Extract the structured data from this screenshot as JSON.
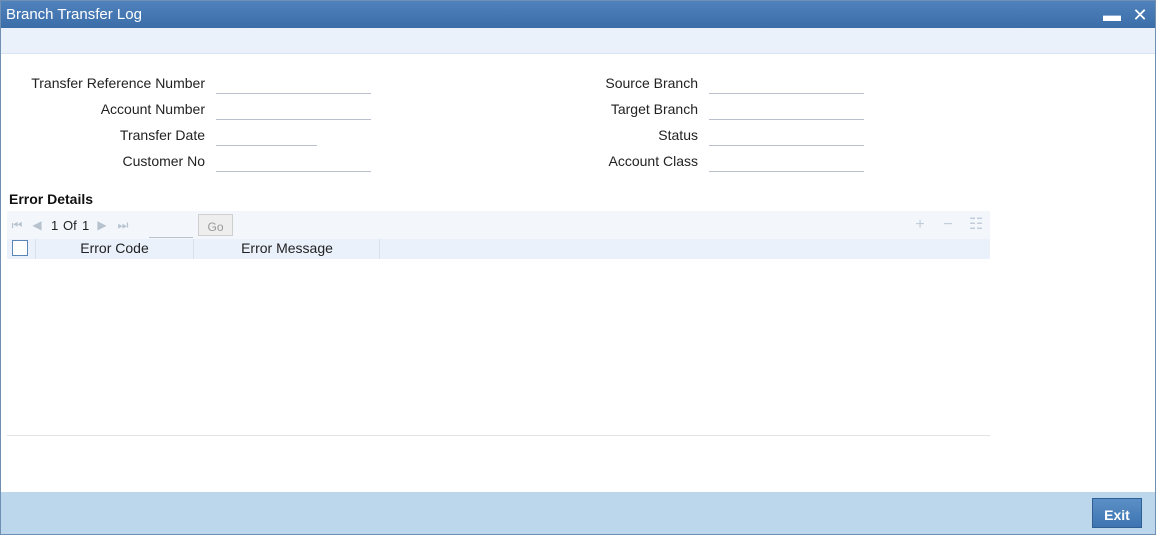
{
  "window": {
    "title": "Branch Transfer Log",
    "minimize_icon": "minimize-icon",
    "close_icon": "close-icon"
  },
  "form": {
    "left": [
      {
        "label": "Transfer Reference Number",
        "value": ""
      },
      {
        "label": "Account Number",
        "value": ""
      },
      {
        "label": "Transfer Date",
        "value": ""
      },
      {
        "label": "Customer No",
        "value": ""
      }
    ],
    "right": [
      {
        "label": "Source Branch",
        "value": ""
      },
      {
        "label": "Target Branch",
        "value": ""
      },
      {
        "label": "Status",
        "value": ""
      },
      {
        "label": "Account Class",
        "value": ""
      }
    ]
  },
  "error_details": {
    "title": "Error Details",
    "pager": {
      "current": "1",
      "of_label": "Of",
      "total": "1",
      "go_label": "Go",
      "page_value": ""
    },
    "columns": [
      "Error Code",
      "Error Message"
    ],
    "rows": []
  },
  "footer": {
    "exit_label": "Exit"
  },
  "colors": {
    "titlebar": "#4a7cb9",
    "footer": "#bcd6ec",
    "exit_button": "#4a82bf"
  }
}
